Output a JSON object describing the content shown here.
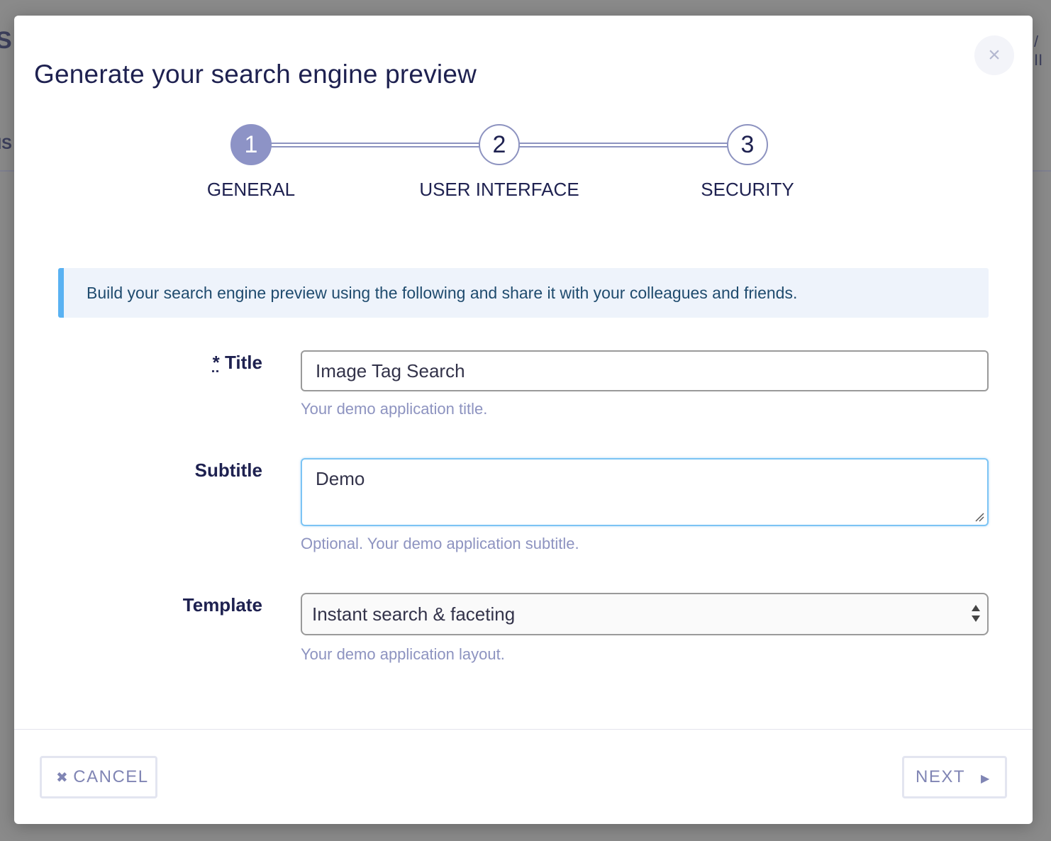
{
  "background": {
    "frag_top": "S",
    "frag_mid": "IS",
    "frag_right": "/ II"
  },
  "modal": {
    "title": "Generate your search engine preview",
    "close_icon": "×"
  },
  "stepper": {
    "steps": [
      {
        "number": "1",
        "label": "GENERAL",
        "active": true
      },
      {
        "number": "2",
        "label": "USER INTERFACE",
        "active": false
      },
      {
        "number": "3",
        "label": "SECURITY",
        "active": false
      }
    ]
  },
  "info": {
    "text": "Build your search engine preview using the following and share it with your colleagues and friends."
  },
  "form": {
    "title": {
      "required_marker": "*",
      "label": "Title",
      "value": "Image Tag Search",
      "help": "Your demo application title."
    },
    "subtitle": {
      "label": "Subtitle",
      "value": "Demo",
      "help": "Optional. Your demo application subtitle."
    },
    "template": {
      "label": "Template",
      "selected": "Instant search & faceting",
      "help": "Your demo application layout."
    }
  },
  "footer": {
    "cancel_icon": "✖",
    "cancel_label": "CANCEL",
    "next_label": "NEXT",
    "next_icon": "▶"
  },
  "colors": {
    "accent": "#8d93c6",
    "info_border": "#5ab2f2",
    "help_text": "#8d93c0"
  }
}
